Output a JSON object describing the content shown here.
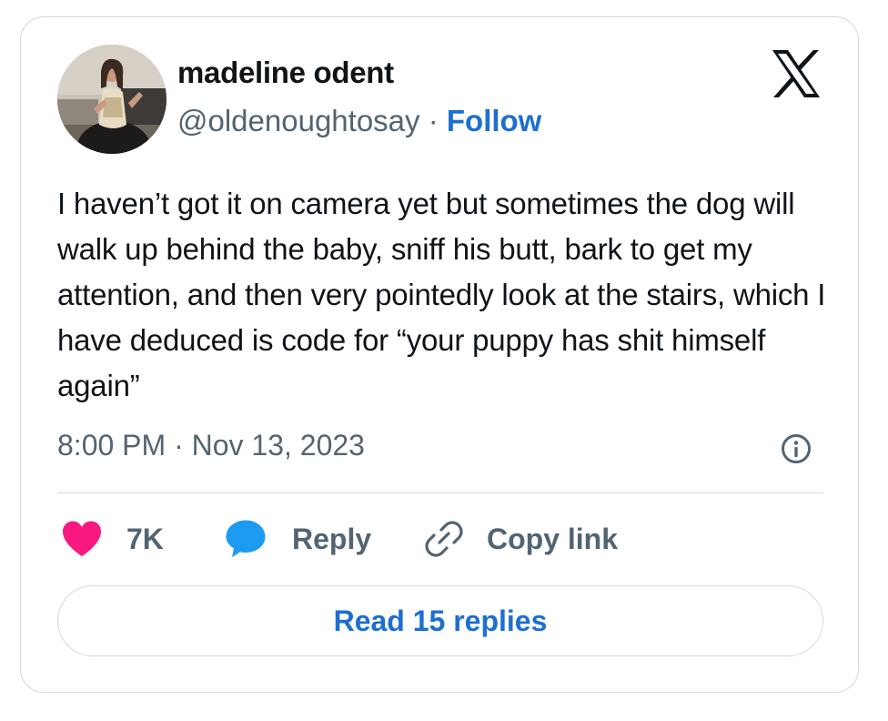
{
  "author": {
    "display_name": "madeline odent",
    "handle": "@oldenoughtosay",
    "separator": "·",
    "follow_label": "Follow"
  },
  "tweet": {
    "text": "I haven’t got it on camera yet but sometimes the dog will walk up behind the baby, sniff his butt, bark to get my attention, and then very pointedly look at the stairs, which I have deduced is code for “your puppy has shit himself again”",
    "timestamp": "8:00 PM · Nov 13, 2023"
  },
  "actions": {
    "like_count": "7K",
    "reply_label": "Reply",
    "copy_link_label": "Copy link"
  },
  "read_replies_label": "Read 15 replies",
  "icons": {
    "brand": "x-logo-icon",
    "info": "info-icon",
    "like": "heart-icon",
    "reply": "speech-bubble-icon",
    "copy": "link-icon"
  },
  "colors": {
    "link_blue": "#1d6fd0",
    "heart_pink": "#f91880",
    "reply_blue": "#1d9bf0",
    "muted_text": "#536471",
    "border": "#cfd9de"
  }
}
